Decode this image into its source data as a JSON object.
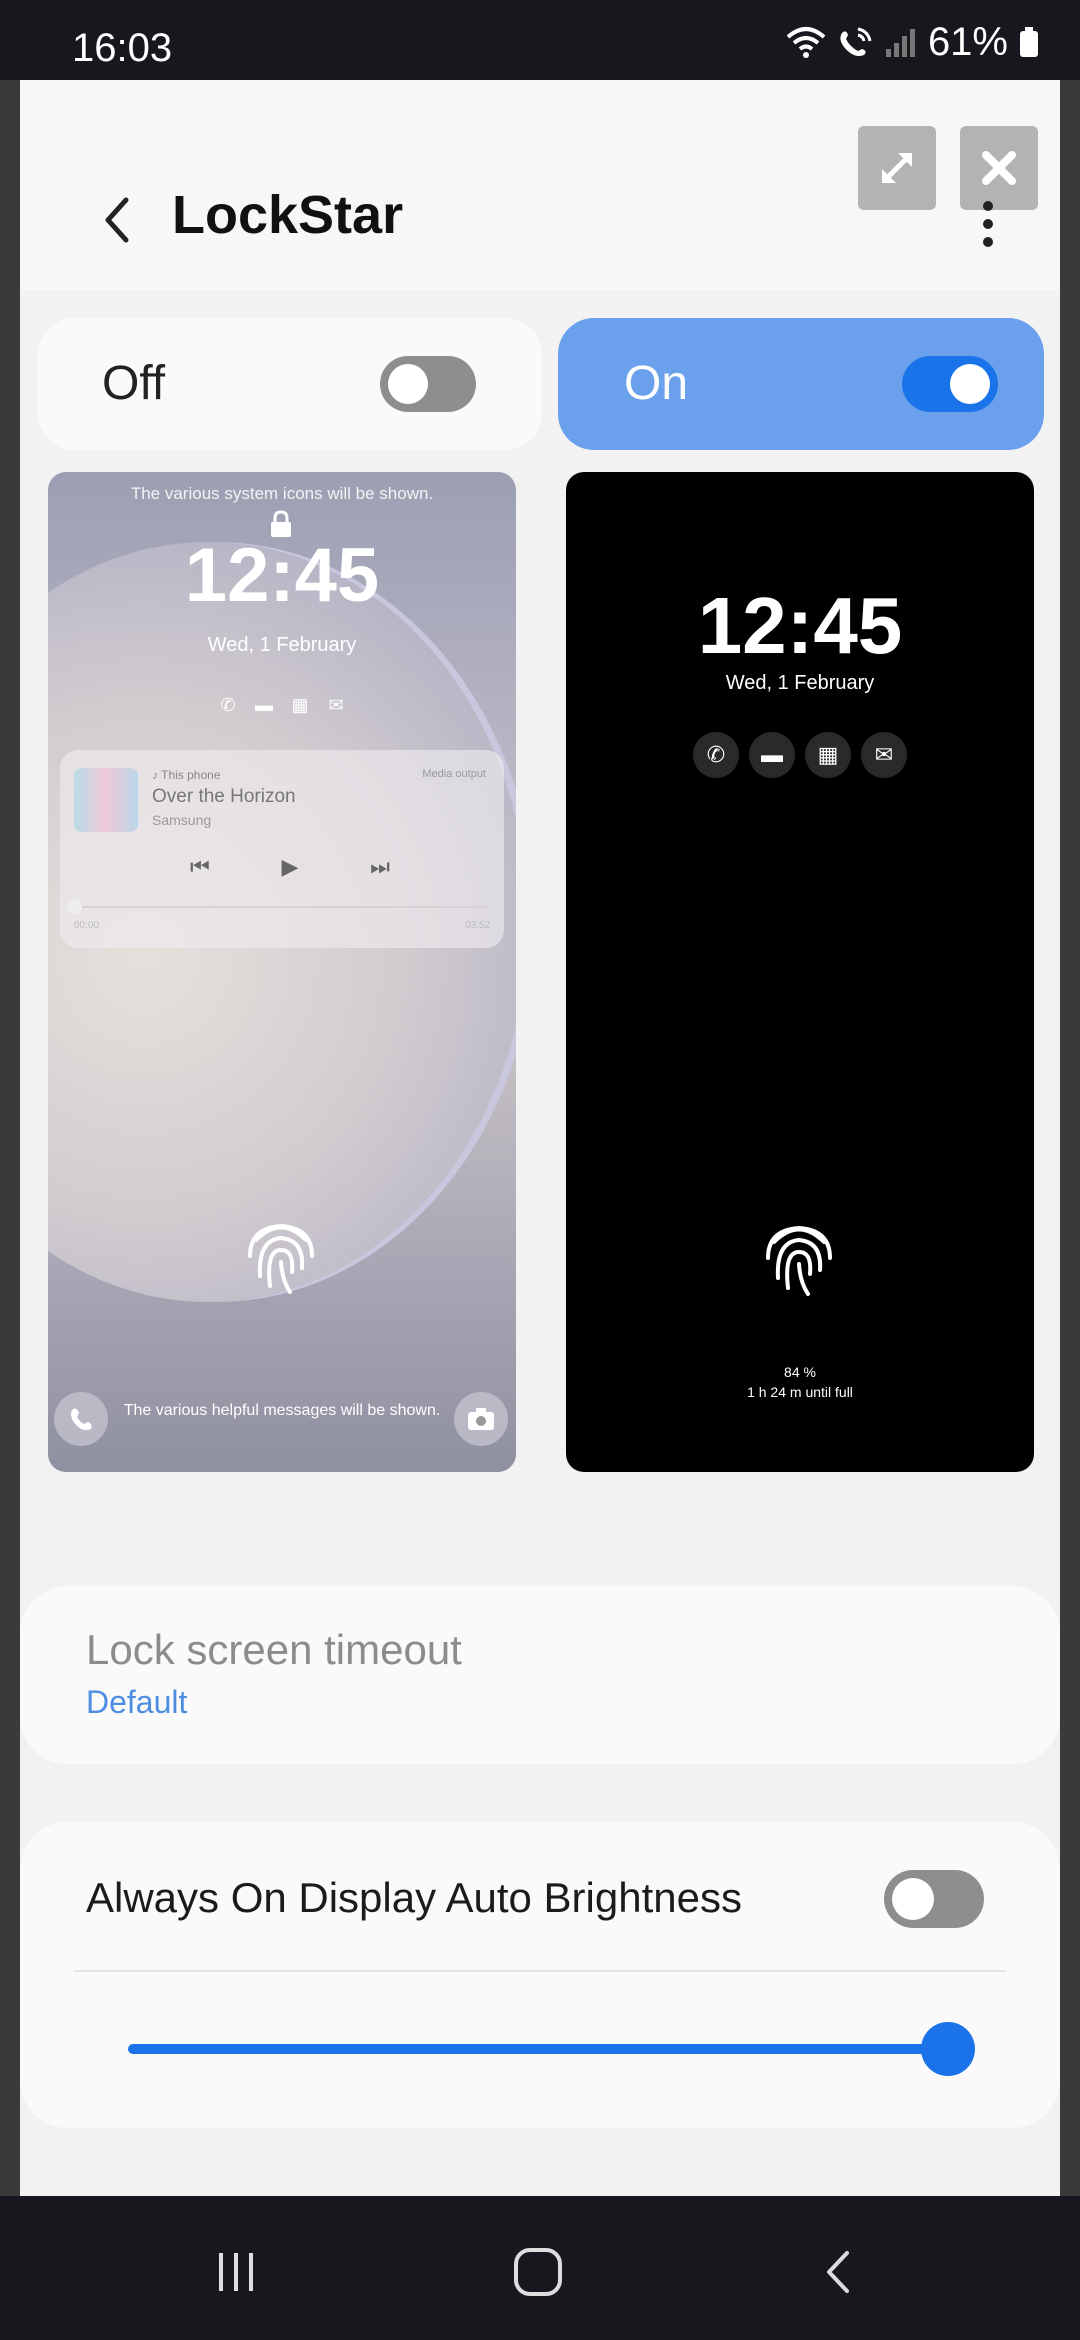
{
  "status_bar": {
    "time": "16:03",
    "battery_percent": "61%",
    "icons": [
      "wifi-icon",
      "wifi-calling-icon",
      "signal-icon",
      "battery-icon"
    ]
  },
  "app_bar": {
    "title": "LockStar",
    "back_icon": "chevron-left-icon",
    "more_icon": "more-vert-icon"
  },
  "window_controls": {
    "expand_icon": "expand-icon",
    "close_icon": "close-icon"
  },
  "toggle_options": [
    {
      "label": "Off",
      "selected": false
    },
    {
      "label": "On",
      "selected": true
    }
  ],
  "preview_off": {
    "system_msg": "The various system icons will be shown.",
    "time": "12:45",
    "date": "Wed, 1 February",
    "icons": [
      "phone-icon",
      "message-icon",
      "calendar-icon",
      "email-icon"
    ],
    "media": {
      "source": "♪ This phone",
      "output": "Media output",
      "title": "Over the Horizon",
      "artist": "Samsung",
      "time_start": "00:00",
      "time_end": "03:52"
    },
    "help_msg": "The various helpful messages will be shown."
  },
  "preview_on": {
    "time": "12:45",
    "date": "Wed, 1 February",
    "icons": [
      "phone-icon",
      "message-icon",
      "calendar-icon",
      "email-icon"
    ],
    "battery": "84 %",
    "charge_msg": "1 h 24 m until full"
  },
  "settings": {
    "lock_timeout": {
      "title": "Lock screen timeout",
      "value": "Default"
    },
    "aod_brightness": {
      "title": "Always On Display Auto Brightness",
      "enabled": false,
      "level": 1.0
    }
  },
  "nav_bar": {
    "icons": [
      "recents-icon",
      "home-icon",
      "back-icon"
    ]
  },
  "colors": {
    "accent": "#1a73e8",
    "on_card": "#6aa0ec",
    "link": "#4e8ee0"
  }
}
